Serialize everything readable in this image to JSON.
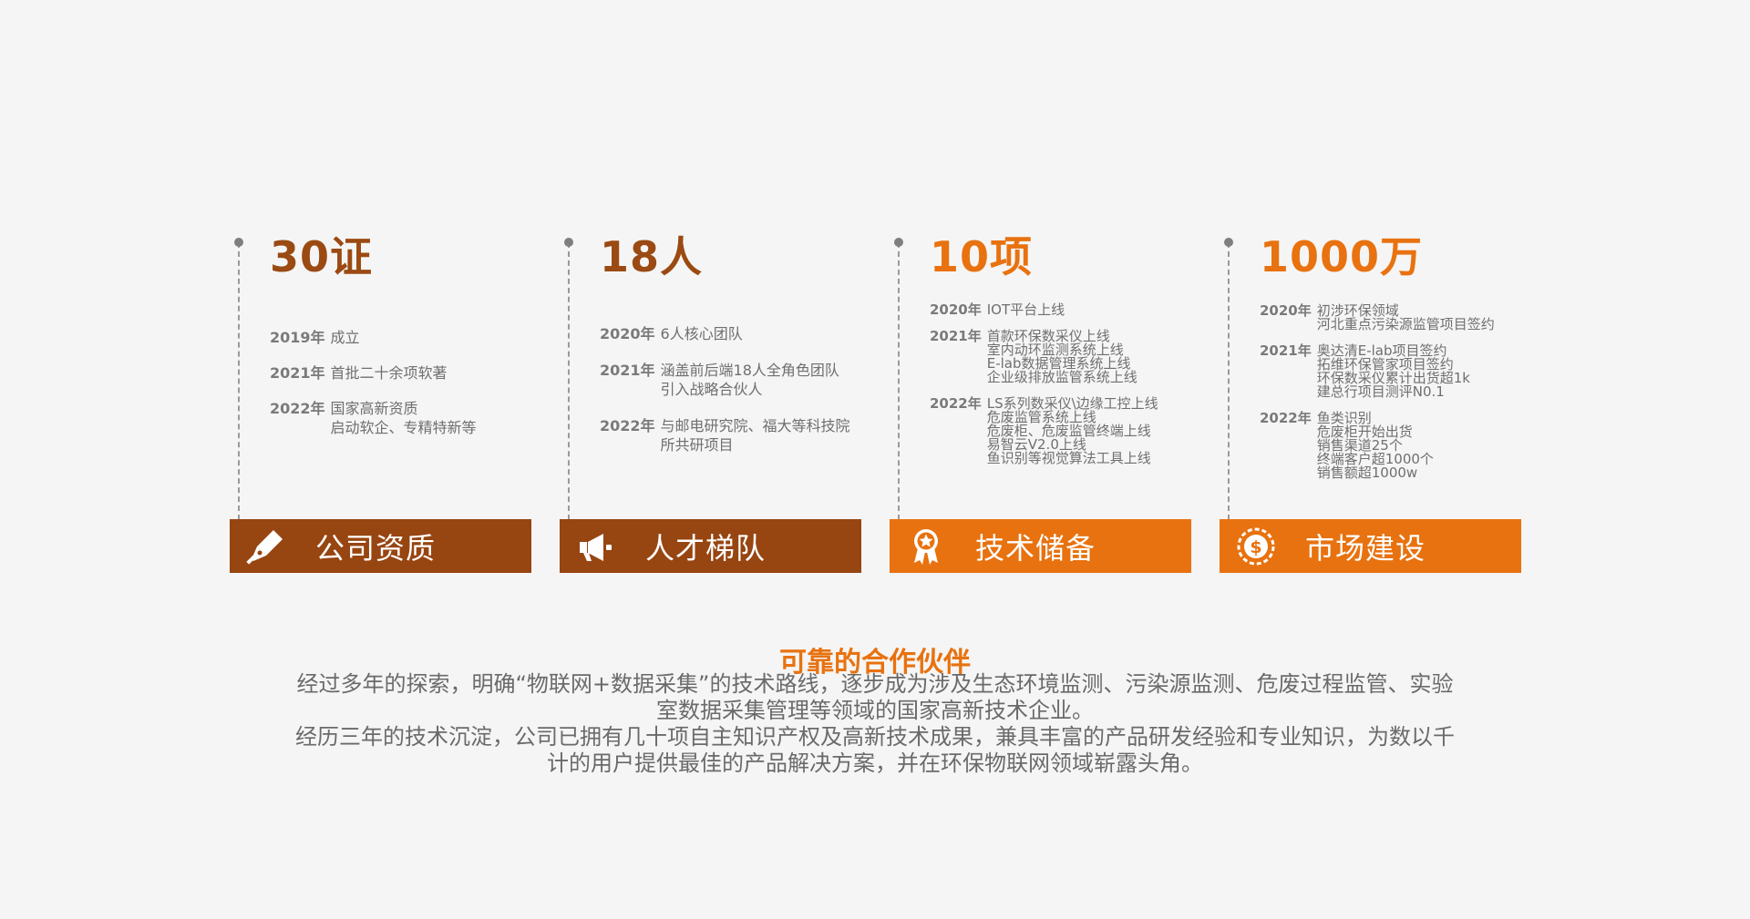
{
  "columns": [
    {
      "stat": "30证",
      "stat_color": "#9a4a12",
      "band_label": "公司资质",
      "band_color": "#974511",
      "icon": "pen-nib-icon",
      "entries": [
        {
          "year": "2019年",
          "lines": [
            "成立"
          ]
        },
        {
          "year": "2021年",
          "lines": [
            "首批二十余项软著"
          ]
        },
        {
          "year": "2022年",
          "lines": [
            "国家高新资质",
            "启动软企、专精特新等"
          ]
        }
      ]
    },
    {
      "stat": "18人",
      "stat_color": "#9a4a12",
      "band_label": "人才梯队",
      "band_color": "#974511",
      "icon": "megaphone-icon",
      "entries": [
        {
          "year": "2020年",
          "lines": [
            "6人核心团队"
          ]
        },
        {
          "year": "2021年",
          "lines": [
            "涵盖前后端18人全角色团队",
            "引入战略合伙人"
          ]
        },
        {
          "year": "2022年",
          "lines": [
            "与邮电研究院、福大等科技院",
            "所共研项目"
          ]
        }
      ]
    },
    {
      "stat": "10项",
      "stat_color": "#e8720f",
      "band_label": "技术储备",
      "band_color": "#e8720f",
      "icon": "award-ribbon-icon",
      "entries": [
        {
          "year": "2020年",
          "lines": [
            "IOT平台上线"
          ]
        },
        {
          "year": "2021年",
          "lines": [
            "首款环保数采仪上线",
            "室内动环监测系统上线",
            "E-lab数据管理系统上线",
            "企业级排放监管系统上线"
          ]
        },
        {
          "year": "2022年",
          "lines": [
            "LS系列数采仪\\边缘工控上线",
            "危废监管系统上线",
            "危废柜、危废监管终端上线",
            "易智云V2.0上线",
            "鱼识别等视觉算法工具上线"
          ]
        }
      ]
    },
    {
      "stat": "1000万",
      "stat_color": "#e8720f",
      "band_label": "市场建设",
      "band_color": "#e8720f",
      "icon": "dollar-coin-icon",
      "entries": [
        {
          "year": "2020年",
          "lines": [
            "初涉环保领域",
            "河北重点污染源监管项目签约"
          ]
        },
        {
          "year": "2021年",
          "lines": [
            "奥达清E-lab项目签约",
            "拓维环保管家项目签约",
            "环保数采仪累计出货超1k",
            "建总行项目测评N0.1"
          ]
        },
        {
          "year": "2022年",
          "lines": [
            "鱼类识别",
            "危废柜开始出货",
            "销售渠道25个",
            "终端客户超1000个",
            "销售额超1000w"
          ]
        }
      ]
    }
  ],
  "section": {
    "heading": "可靠的合作伙伴",
    "paragraph_lines": [
      "经过多年的探索，明确“物联网+数据采集”的技术路线，逐步成为涉及生态环境监测、污染源监测、危废过程监管、实验",
      "室数据采集管理等领域的国家高新技术企业。",
      "经历三年的技术沉淀，公司已拥有几十项自主知识产权及高新技术成果，兼具丰富的产品研发经验和专业知识，为数以千",
      "计的用户提供最佳的产品解决方案，并在环保物联网领域崭露头角。"
    ]
  }
}
